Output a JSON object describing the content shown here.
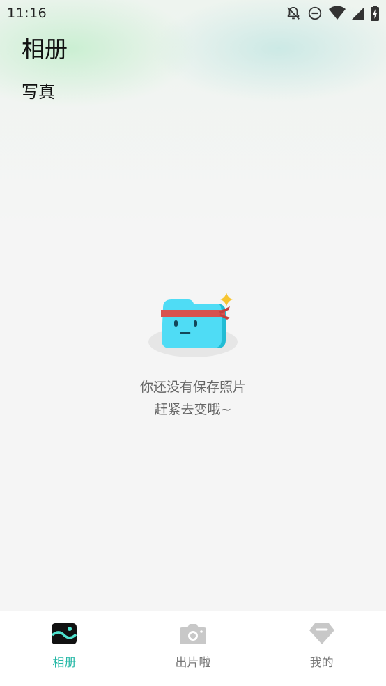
{
  "status_bar": {
    "time": "11:16",
    "icons": [
      "bell-off-icon",
      "do-not-disturb-icon",
      "wifi-icon",
      "signal-icon",
      "battery-charging-icon"
    ]
  },
  "header": {
    "title": "相册",
    "section": "写真"
  },
  "empty_state": {
    "icon": "ninja-bag-mascot",
    "line1": "你还没有保存照片",
    "line2": "赶紧去变哦~"
  },
  "tab_bar": {
    "tabs": [
      {
        "label": "相册",
        "icon": "album-icon",
        "active": true
      },
      {
        "label": "出片啦",
        "icon": "camera-icon",
        "active": false
      },
      {
        "label": "我的",
        "icon": "diamond-icon",
        "active": false
      }
    ]
  },
  "colors": {
    "accent": "#25b8a6",
    "mascot": "#4fdcf5",
    "headband": "#d8524f",
    "sparkle": "#f7c531"
  }
}
